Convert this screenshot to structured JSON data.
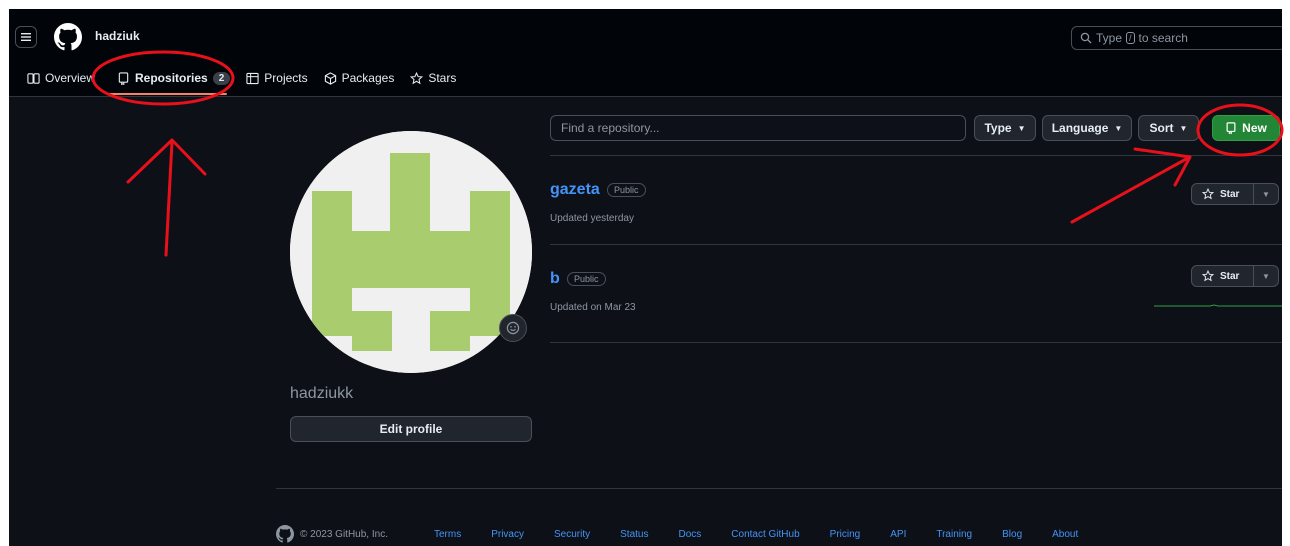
{
  "header": {
    "username": "hadziuk",
    "search_prefix": "Type",
    "search_key": "/",
    "search_suffix": "to search"
  },
  "nav": {
    "overview": "Overview",
    "repositories": "Repositories",
    "repositories_count": "2",
    "projects": "Projects",
    "packages": "Packages",
    "stars": "Stars"
  },
  "profile": {
    "name": "hadziukk",
    "edit_label": "Edit profile"
  },
  "toolbar": {
    "find_placeholder": "Find a repository...",
    "type_label": "Type",
    "language_label": "Language",
    "sort_label": "Sort",
    "new_label": "New"
  },
  "repos": [
    {
      "name": "gazeta",
      "visibility": "Public",
      "updated": "Updated yesterday",
      "star_label": "Star"
    },
    {
      "name": "b",
      "visibility": "Public",
      "updated": "Updated on Mar 23",
      "star_label": "Star"
    }
  ],
  "footer": {
    "copyright": "© 2023 GitHub, Inc.",
    "links": [
      "Terms",
      "Privacy",
      "Security",
      "Status",
      "Docs",
      "Contact GitHub",
      "Pricing",
      "API",
      "Training",
      "Blog",
      "About"
    ]
  },
  "colors": {
    "background": "#0d1117",
    "header": "#010409",
    "link": "#4493f8",
    "new_button": "#238636",
    "annotation": "#e8101b",
    "avatar": "#a8cc6e"
  },
  "icons": [
    "hamburger-icon",
    "github-logo-icon",
    "search-icon",
    "book-icon",
    "repo-icon",
    "table-icon",
    "package-icon",
    "star-icon",
    "smiley-icon"
  ]
}
